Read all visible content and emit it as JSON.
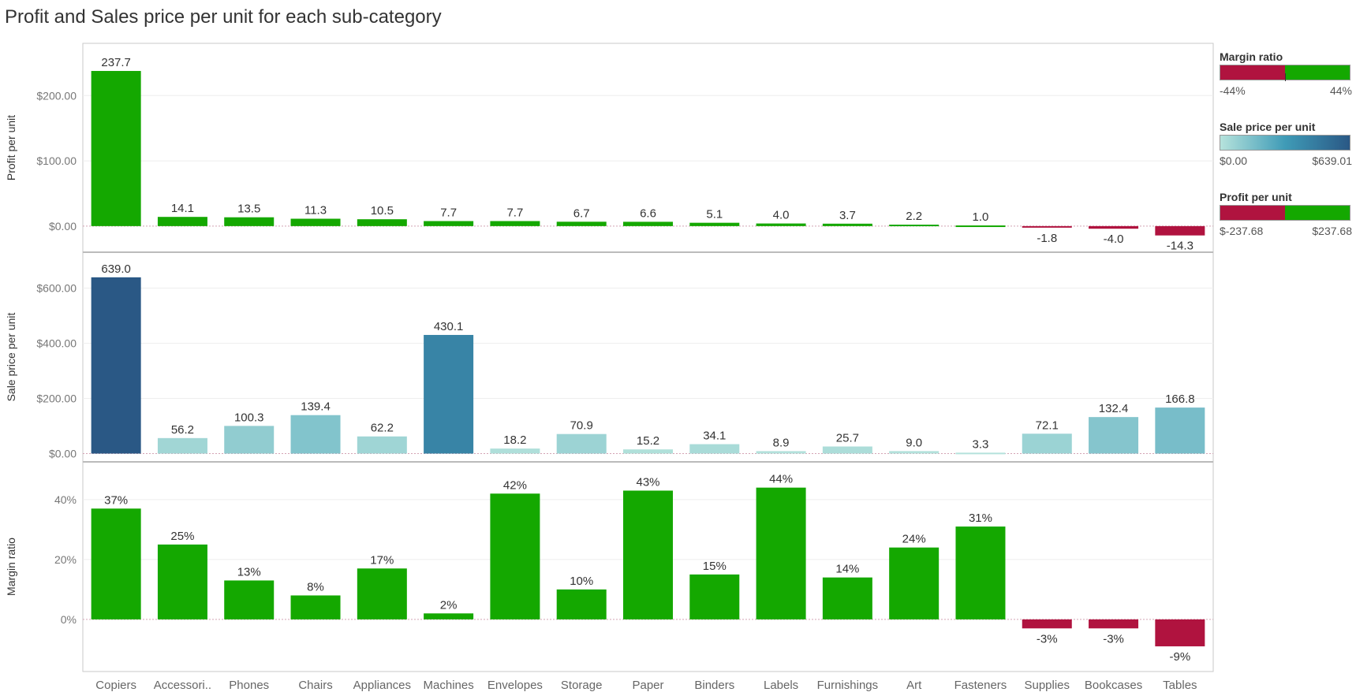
{
  "title": "Profit and Sales price per unit for each sub-category",
  "colors": {
    "positive": "#14a800",
    "negative": "#b0133f",
    "seq_low": "#b6e3dc",
    "seq_mid": "#3f9bb7",
    "seq_high": "#2a5885"
  },
  "legends": {
    "margin": {
      "title": "Margin ratio",
      "min": "-44%",
      "max": "44%"
    },
    "sale": {
      "title": "Sale price per unit",
      "min": "$0.00",
      "max": "$639.01"
    },
    "profit": {
      "title": "Profit per unit",
      "min": "$-237.68",
      "max": "$237.68"
    }
  },
  "chart_data": [
    {
      "type": "bar",
      "title": "",
      "ylabel": "Profit per unit",
      "categories": [
        "Copiers",
        "Accessori..",
        "Phones",
        "Chairs",
        "Appliances",
        "Machines",
        "Envelopes",
        "Storage",
        "Paper",
        "Binders",
        "Labels",
        "Furnishings",
        "Art",
        "Fasteners",
        "Supplies",
        "Bookcases",
        "Tables"
      ],
      "values": [
        237.7,
        14.1,
        13.5,
        11.3,
        10.5,
        7.7,
        7.7,
        6.7,
        6.6,
        5.1,
        4.0,
        3.7,
        2.2,
        1.0,
        -1.8,
        -4.0,
        -14.3
      ],
      "labels": [
        "237.7",
        "14.1",
        "13.5",
        "11.3",
        "10.5",
        "7.7",
        "7.7",
        "6.7",
        "6.6",
        "5.1",
        "4.0",
        "3.7",
        "2.2",
        "1.0",
        "-1.8",
        "-4.0",
        "-14.3"
      ],
      "yticks": [
        0,
        100,
        200
      ],
      "ytick_labels": [
        "$0.00",
        "$100.00",
        "$200.00"
      ],
      "ylim": [
        -40,
        280
      ],
      "color_by": "margin_ratio_sign"
    },
    {
      "type": "bar",
      "title": "",
      "ylabel": "Sale price per unit",
      "categories": [
        "Copiers",
        "Accessori..",
        "Phones",
        "Chairs",
        "Appliances",
        "Machines",
        "Envelopes",
        "Storage",
        "Paper",
        "Binders",
        "Labels",
        "Furnishings",
        "Art",
        "Fasteners",
        "Supplies",
        "Bookcases",
        "Tables"
      ],
      "values": [
        639.0,
        56.2,
        100.3,
        139.4,
        62.2,
        430.1,
        18.2,
        70.9,
        15.2,
        34.1,
        8.9,
        25.7,
        9.0,
        3.3,
        72.1,
        132.4,
        166.8
      ],
      "labels": [
        "639.0",
        "56.2",
        "100.3",
        "139.4",
        "62.2",
        "430.1",
        "18.2",
        "70.9",
        "15.2",
        "34.1",
        "8.9",
        "25.7",
        "9.0",
        "3.3",
        "72.1",
        "132.4",
        "166.8"
      ],
      "yticks": [
        0,
        200,
        400,
        600
      ],
      "ytick_labels": [
        "$0.00",
        "$200.00",
        "$400.00",
        "$600.00"
      ],
      "ylim": [
        -30,
        730
      ],
      "color_by": "sale_price_gradient"
    },
    {
      "type": "bar",
      "title": "",
      "ylabel": "Margin ratio",
      "categories": [
        "Copiers",
        "Accessori..",
        "Phones",
        "Chairs",
        "Appliances",
        "Machines",
        "Envelopes",
        "Storage",
        "Paper",
        "Binders",
        "Labels",
        "Furnishings",
        "Art",
        "Fasteners",
        "Supplies",
        "Bookcases",
        "Tables"
      ],
      "values": [
        37,
        25,
        13,
        8,
        17,
        2,
        42,
        10,
        43,
        15,
        44,
        14,
        24,
        31,
        -3,
        -3,
        -9
      ],
      "labels": [
        "37%",
        "25%",
        "13%",
        "8%",
        "17%",
        "2%",
        "42%",
        "10%",
        "43%",
        "15%",
        "44%",
        "14%",
        "24%",
        "31%",
        "-3%",
        "-3%",
        "-9%"
      ],
      "yticks": [
        0,
        20,
        40
      ],
      "ytick_labels": [
        "0%",
        "20%",
        "40%"
      ],
      "ylim": [
        -17.4,
        52.6
      ],
      "color_by": "sign"
    }
  ]
}
